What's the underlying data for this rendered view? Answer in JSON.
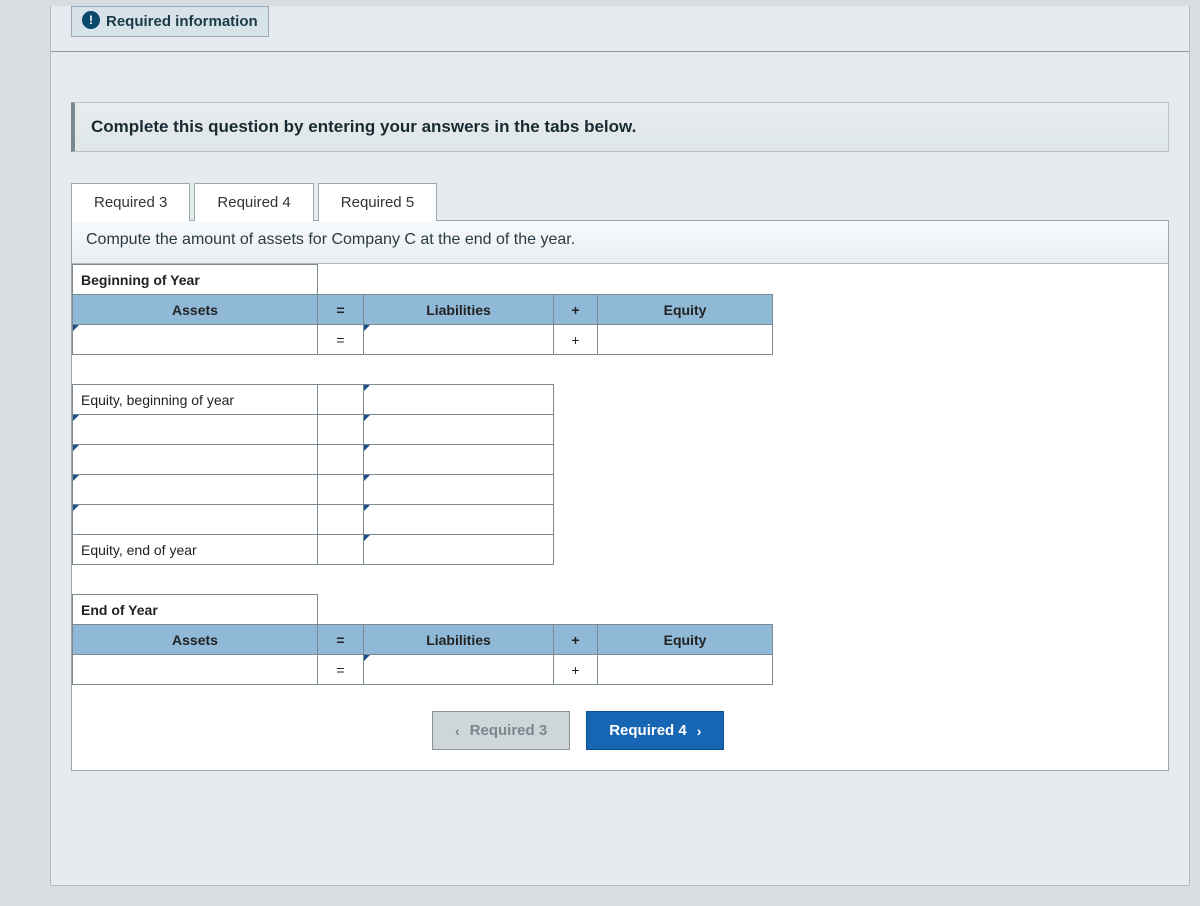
{
  "header": {
    "required_information": "Required information"
  },
  "instruction": "Complete this question by entering your answers in the tabs below.",
  "tabs": [
    {
      "label": "Required 3"
    },
    {
      "label": "Required 4"
    },
    {
      "label": "Required 5"
    }
  ],
  "prompt": "Compute the amount of assets for Company C at the end of the year.",
  "table": {
    "section_begin": "Beginning of Year",
    "col_assets": "Assets",
    "op_eq": "=",
    "col_liab": "Liabilities",
    "op_plus": "+",
    "col_equity": "Equity",
    "equity_begin": "Equity, beginning of year",
    "equity_end": "Equity, end of year",
    "section_end": "End of Year"
  },
  "nav": {
    "prev": "Required 3",
    "next": "Required 4"
  }
}
